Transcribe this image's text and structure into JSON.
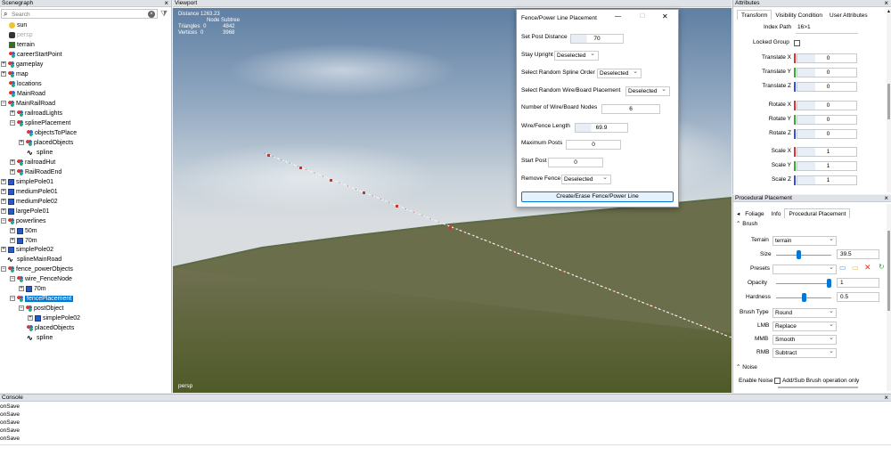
{
  "scenegraph": {
    "title": "Scenegraph",
    "close": "×",
    "search_placeholder": "Search",
    "items": [
      {
        "label": "sun",
        "icon": "sun-icon"
      },
      {
        "label": "persp",
        "icon": "camera-icon"
      },
      {
        "label": "terrain",
        "icon": "terrain-icon"
      },
      {
        "label": "careerStartPoint",
        "icon": "group-icon"
      },
      {
        "label": "gameplay",
        "icon": "group-icon"
      },
      {
        "label": "map",
        "icon": "group-icon"
      },
      {
        "label": "locations",
        "icon": "group-icon"
      },
      {
        "label": "MainRoad",
        "icon": "group-icon"
      },
      {
        "label": "MainRailRoad",
        "icon": "group-icon"
      },
      {
        "label": "railroadLights",
        "icon": "group-icon"
      },
      {
        "label": "splinePlacement",
        "icon": "group-icon"
      },
      {
        "label": "objectsToPlace",
        "icon": "group-icon"
      },
      {
        "label": "placedObjects",
        "icon": "group-icon"
      },
      {
        "label": "spline",
        "icon": "spline-icon"
      },
      {
        "label": "railroadHut",
        "icon": "group-icon"
      },
      {
        "label": "RailRoadEnd",
        "icon": "group-icon"
      },
      {
        "label": "simplePole01",
        "icon": "cube-icon"
      },
      {
        "label": "mediumPole01",
        "icon": "cube-icon"
      },
      {
        "label": "mediumPole02",
        "icon": "cube-icon"
      },
      {
        "label": "largePole01",
        "icon": "cube-icon"
      },
      {
        "label": "powerlines",
        "icon": "group-icon"
      },
      {
        "label": "50m",
        "icon": "cube-icon"
      },
      {
        "label": "70m",
        "icon": "cube-icon"
      },
      {
        "label": "simplePole02",
        "icon": "cube-icon"
      },
      {
        "label": "splineMainRoad",
        "icon": "spline-icon"
      },
      {
        "label": "fence_powerObjects",
        "icon": "group-icon"
      },
      {
        "label": "wire_FenceNode",
        "icon": "group-icon"
      },
      {
        "label": "70m",
        "icon": "cube-icon"
      },
      {
        "label": "fencePlacement",
        "icon": "group-icon"
      },
      {
        "label": "postObject",
        "icon": "group-icon"
      },
      {
        "label": "simplePole02",
        "icon": "cube-icon"
      },
      {
        "label": "placedObjects",
        "icon": "group-icon"
      },
      {
        "label": "spline",
        "icon": "spline-icon"
      }
    ]
  },
  "viewport": {
    "title": "Viewport",
    "stats": {
      "distance_label": "Distance",
      "distance_value": "1263.23",
      "header": "Node Subtree",
      "triangles_label": "Triangles",
      "triangles_node": "0",
      "triangles_subtree": "4842",
      "vertices_label": "Vertices",
      "vertices_node": "0",
      "vertices_subtree": "3968"
    },
    "camera_label": "persp"
  },
  "dialog": {
    "title": "Fence/Power Line Placement",
    "minimize": "—",
    "maximize": "☐",
    "close": "✕",
    "set_post_distance_label": "Set Post Distance",
    "set_post_distance_value": "70",
    "stay_upright_label": "Stay Upright",
    "stay_upright_value": "Deselected",
    "random_spline_order_label": "Select Random Spline Order",
    "random_spline_order_value": "Deselected",
    "random_wire_label": "Select Random Wire/Board Placement",
    "random_wire_value": "Deselected",
    "num_wire_nodes_label": "Number of Wire/Board Nodes",
    "num_wire_nodes_value": "6",
    "wire_length_label": "Wire/Fence Length",
    "wire_length_value": "69.9",
    "max_posts_label": "Maximum Posts",
    "max_posts_value": "0",
    "start_post_label": "Start Post",
    "start_post_value": "0",
    "remove_fence_label": "Remove Fence",
    "remove_fence_value": "Deselected",
    "create_button": "Create/Erase Fence/Power Line"
  },
  "attributes": {
    "title": "Attributes",
    "tabs": [
      "Transform",
      "Visibility Condition",
      "User Attributes"
    ],
    "index_path_label": "Index Path",
    "index_path_value": "16>1",
    "locked_group_label": "Locked Group",
    "rows": [
      {
        "label": "Translate X",
        "value": "0",
        "color": "#e03030"
      },
      {
        "label": "Translate Y",
        "value": "0",
        "color": "#30b030"
      },
      {
        "label": "Translate Z",
        "value": "0",
        "color": "#3050e0"
      },
      {
        "label": "Rotate X",
        "value": "0",
        "color": "#e03030"
      },
      {
        "label": "Rotate Y",
        "value": "0",
        "color": "#30b030"
      },
      {
        "label": "Rotate Z",
        "value": "0",
        "color": "#3050e0"
      },
      {
        "label": "Scale X",
        "value": "1",
        "color": "#e03030"
      },
      {
        "label": "Scale Y",
        "value": "1",
        "color": "#30b030"
      },
      {
        "label": "Scale Z",
        "value": "1",
        "color": "#3050e0"
      }
    ]
  },
  "procedural": {
    "title": "Procedural Placement",
    "tabs": [
      "Foliage",
      "Info",
      "Procedural Placement"
    ],
    "brush_section": "Brush",
    "terrain_label": "Terrain",
    "terrain_value": "terrain",
    "size_label": "Size",
    "size_value": "39.5",
    "size_level": 0.4,
    "presets_label": "Presets",
    "opacity_label": "Opacity",
    "opacity_value": "1",
    "opacity_level": 1.0,
    "hardness_label": "Hardness",
    "hardness_value": "0.5",
    "hardness_level": 0.5,
    "brush_type_label": "Brush Type",
    "brush_type_value": "Round",
    "lmb_label": "LMB",
    "lmb_value": "Replace",
    "mmb_label": "MMB",
    "mmb_value": "Smooth",
    "rmb_label": "RMB",
    "rmb_value": "Subtract",
    "noise_section": "Noise",
    "enable_noise_label": "Enable Noise",
    "noise_note": "Add/Sub Brush operation only"
  },
  "console": {
    "title": "Console",
    "lines": [
      "onSave",
      "onSave",
      "onSave",
      "onSave",
      "onSave"
    ]
  }
}
